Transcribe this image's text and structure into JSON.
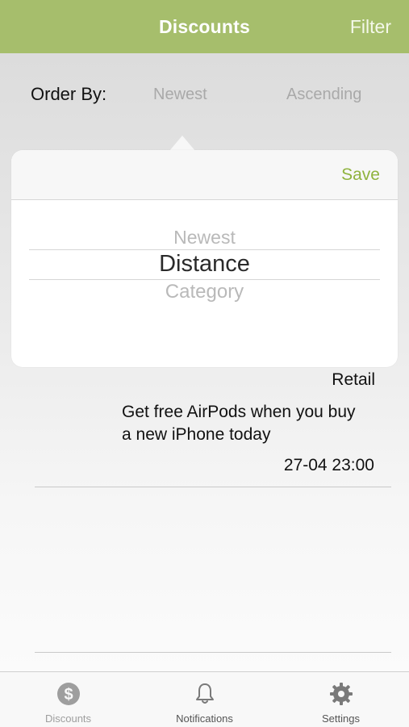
{
  "header": {
    "title": "Discounts",
    "filter_label": "Filter"
  },
  "order_by": {
    "label": "Order By:",
    "sort_field": "Newest",
    "sort_direction": "Ascending"
  },
  "picker": {
    "save_label": "Save",
    "options": [
      "Newest",
      "Distance",
      "Category"
    ],
    "selected": "Distance"
  },
  "list": {
    "items": [
      {
        "category": "Retail",
        "description": "Get free AirPods when you buy a new iPhone today",
        "date": "27-04 23:00"
      }
    ]
  },
  "tabbar": {
    "items": [
      {
        "label": "Discounts",
        "icon": "dollar-circle-icon"
      },
      {
        "label": "Notifications",
        "icon": "bell-icon"
      },
      {
        "label": "Settings",
        "icon": "gear-icon"
      }
    ]
  },
  "colors": {
    "brand": "#a6be6c",
    "accent": "#8fb33e"
  }
}
